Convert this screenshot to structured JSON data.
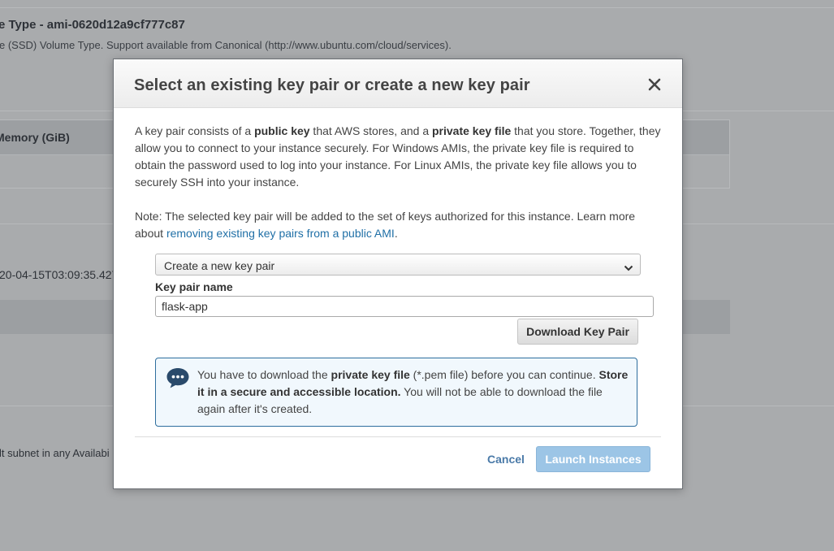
{
  "background": {
    "ami_title": "e Type - ami-0620d12a9cf777c87",
    "ami_desc": "e (SSD) Volume Type. Support available from Canonical (http://www.ubuntu.com/cloud/services).",
    "memory_header": "Memory (GiB)",
    "launch_time": "20-04-15T03:09:35.427",
    "subnet_text": "lt subnet in any Availabi"
  },
  "modal": {
    "title": "Select an existing key pair or create a new key pair",
    "close_icon": "close-icon",
    "intro": {
      "t1": "A key pair consists of a ",
      "b1": "public key",
      "t2": " that AWS stores, and a ",
      "b2": "private key file",
      "t3": " that you store. Together, they allow you to connect to your instance securely. For Windows AMIs, the private key file is required to obtain the password used to log into your instance. For Linux AMIs, the private key file allows you to securely SSH into your instance."
    },
    "note": {
      "text": "Note: The selected key pair will be added to the set of keys authorized for this instance. Learn more about ",
      "link": "removing existing key pairs from a public AMI",
      "end": "."
    },
    "key_pair_select": {
      "value": "Create a new key pair"
    },
    "key_pair_name": {
      "label": "Key pair name",
      "value": "flask-app"
    },
    "download_button": "Download Key Pair",
    "info": {
      "icon": "chat-bubble-icon",
      "t1": "You have to download the ",
      "b1": "private key file",
      "t2": " (*.pem file) before you can continue. ",
      "b2": "Store it in a secure and accessible location.",
      "t3": " You will not be able to download the file again after it's created."
    },
    "cancel_label": "Cancel",
    "launch_label": "Launch Instances"
  },
  "colors": {
    "overlay": "#a9abad",
    "link": "#1f6fa6",
    "info_border": "#2e6e9e",
    "launch_disabled": "#9cc5e6"
  }
}
